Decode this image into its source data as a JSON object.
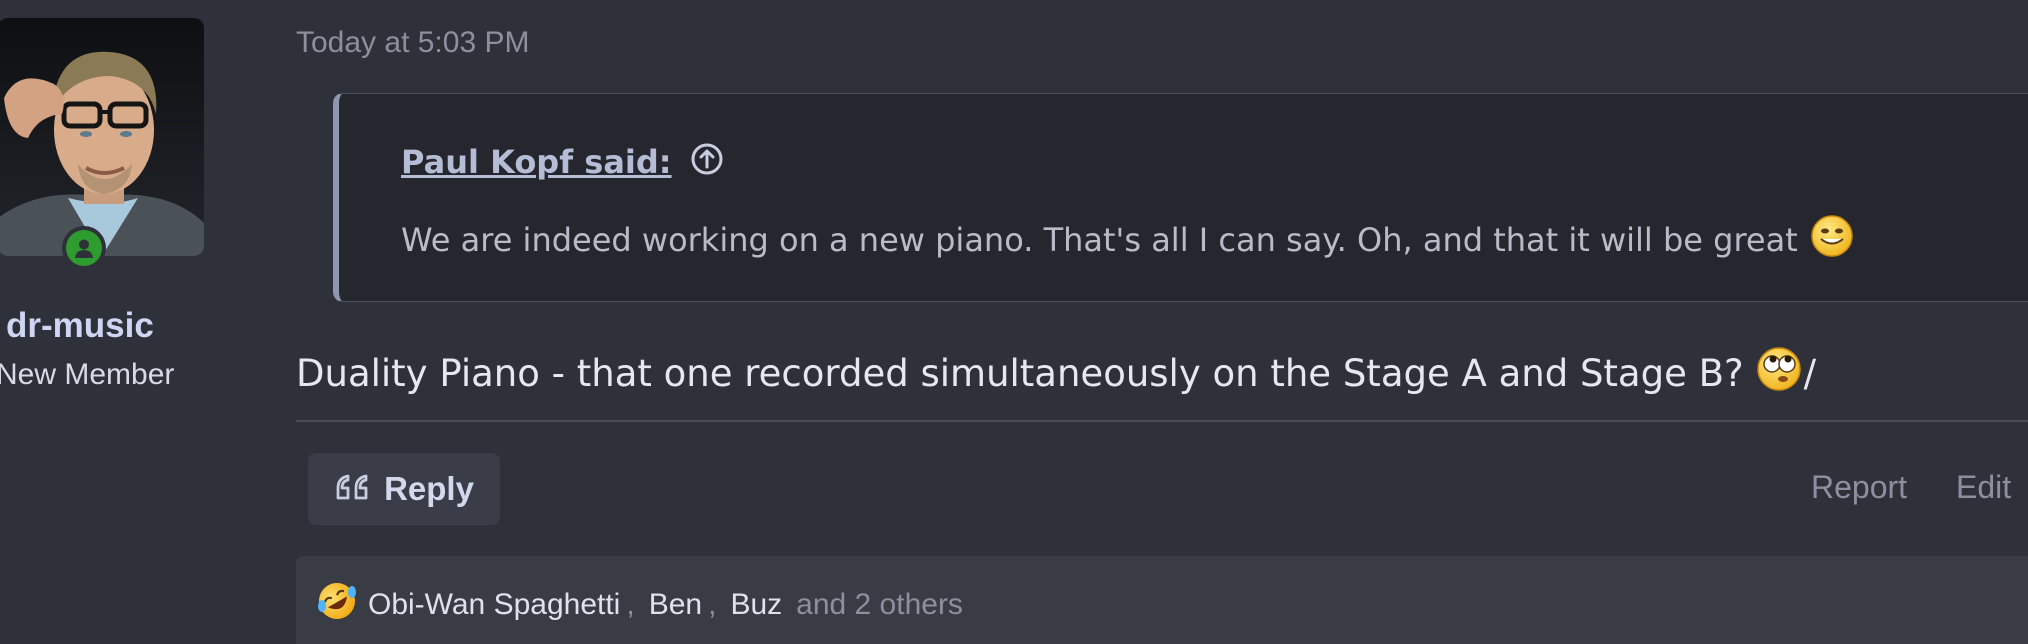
{
  "user": {
    "username": "dr-music",
    "title": "New Member",
    "online": true,
    "online_color": "#2e9c2e"
  },
  "post": {
    "date": "Today at 5:03 PM",
    "quote": {
      "author": "Paul Kopf said:",
      "text": "We are indeed working on a new piano. That's all I can say. Oh, and that it will be great",
      "emoji": "smile-emoji"
    },
    "message": {
      "text": "Duality Piano - that one recorded simultaneously on the Stage A and Stage B?",
      "emoji": "rolling-eyes-emoji",
      "suffix": "/"
    }
  },
  "actions": {
    "reply_label": "Reply",
    "report_label": "Report",
    "edit_label": "Edit"
  },
  "reactions": {
    "emoji": "rofl-emoji",
    "users": [
      "Obi-Wan Spaghetti",
      "Ben",
      "Buz"
    ],
    "separator": ",",
    "others": "and 2 others"
  },
  "colors": {
    "background": "#2f313a",
    "quote_background": "#26272e",
    "quote_border": "#8e97ad",
    "link": "#b5bdd6",
    "muted": "#8c909c"
  }
}
